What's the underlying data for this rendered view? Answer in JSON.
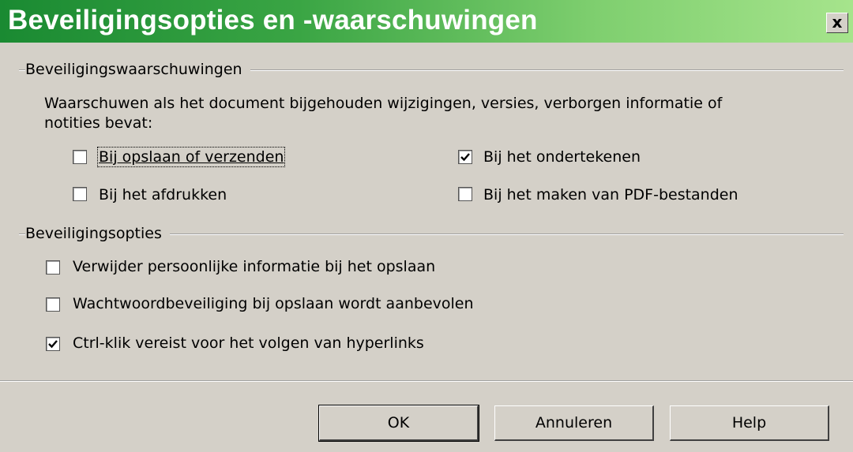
{
  "window": {
    "title": "Beveiligingsopties en -waarschuwingen",
    "close_glyph": "x"
  },
  "warnings": {
    "heading": "Beveiligingswaarschuwingen",
    "description_line1": "Waarschuwen als het document bijgehouden wijzigingen, versies, verborgen informatie of",
    "description_line2": "notities bevat:",
    "options": [
      {
        "label": "Bij opslaan of verzenden",
        "checked": false
      },
      {
        "label": "Bij het ondertekenen",
        "checked": true
      },
      {
        "label": "Bij het afdrukken",
        "checked": false
      },
      {
        "label": "Bij het maken van PDF-bestanden",
        "checked": false
      }
    ]
  },
  "security": {
    "heading": "Beveiligingsopties",
    "options": [
      {
        "label": "Verwijder persoonlijke informatie bij het opslaan",
        "checked": false
      },
      {
        "label": "Wachtwoordbeveiliging bij opslaan wordt aanbevolen",
        "checked": false
      },
      {
        "label": "Ctrl-klik vereist voor het volgen van hyperlinks",
        "checked": true
      }
    ]
  },
  "buttons": {
    "ok": "OK",
    "cancel": "Annuleren",
    "help": "Help"
  },
  "colors": {
    "title_gradient_start": "#1a8a32",
    "title_gradient_end": "#a6e48c",
    "dialog_bg": "#d4d0c8"
  }
}
